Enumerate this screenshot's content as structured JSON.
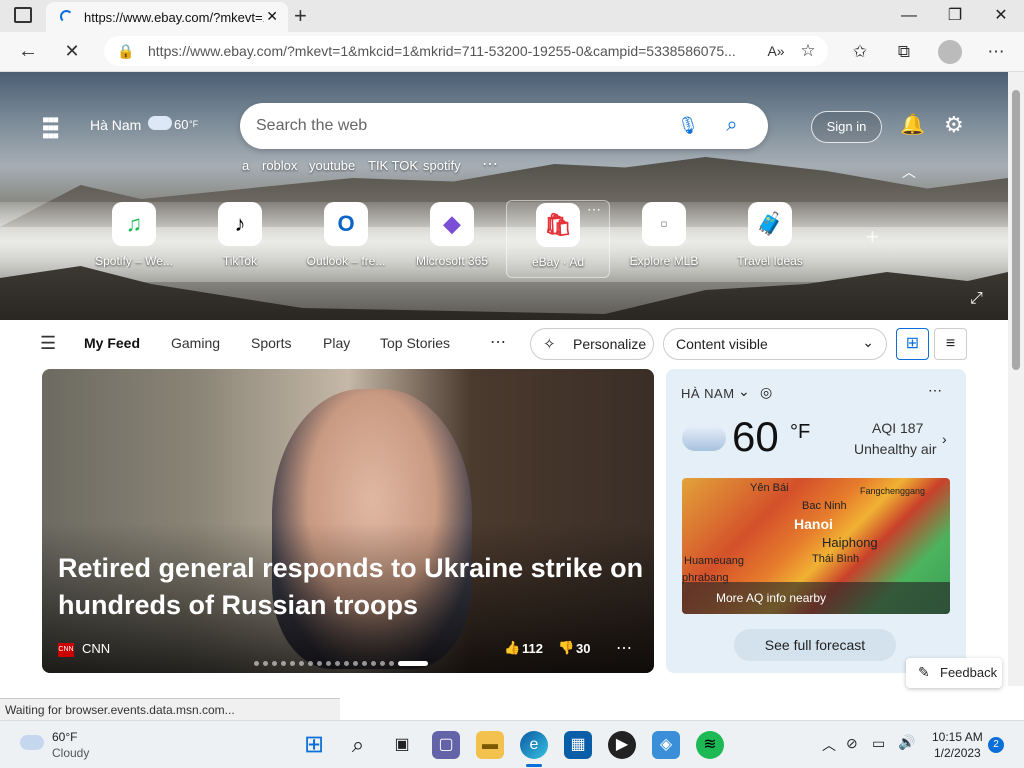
{
  "browser": {
    "tab_title": "https://www.ebay.com/?mkevt=1",
    "tab_close": "✕",
    "new_tab": "+",
    "url": "https://www.ebay.com/?mkevt=1&mkcid=1&mkrid=711-53200-19255-0&campid=5338586075...",
    "status": "Waiting for browser.events.data.msn.com..."
  },
  "hero": {
    "location": "Hà Nam",
    "temp": "60",
    "unit": "°F",
    "search_placeholder": "Search the web",
    "signin": "Sign in",
    "quick_links": [
      "a",
      "roblox",
      "youtube",
      "TIK TOK",
      "spotify"
    ],
    "tiles": [
      {
        "label": "Spotify – We...",
        "icon": "spotify-icon",
        "glyph": "♫",
        "color": "#1db954"
      },
      {
        "label": "TikTok",
        "icon": "tiktok-icon",
        "glyph": "♪",
        "color": "#000000"
      },
      {
        "label": "Outlook – fre...",
        "icon": "outlook-icon",
        "glyph": "O",
        "color": "#0a64c8"
      },
      {
        "label": "Microsoft 365",
        "icon": "microsoft365-icon",
        "glyph": "◆",
        "color": "#7b4ed8"
      },
      {
        "label": "eBay · Ad",
        "icon": "ebay-icon",
        "glyph": "🛍",
        "color": "#e53238"
      },
      {
        "label": "Explore MLB",
        "icon": "mlb-icon",
        "glyph": "▫",
        "color": "#999999"
      },
      {
        "label": "Travel Ideas",
        "icon": "travel-icon",
        "glyph": "🧳",
        "color": "#1e90ff"
      }
    ]
  },
  "feed": {
    "tabs": [
      "My Feed",
      "Gaming",
      "Sports",
      "Play",
      "Top Stories"
    ],
    "personalize": "Personalize",
    "content_visible": "Content visible"
  },
  "article": {
    "headline": "Retired general responds to Ukraine strike on hundreds of Russian troops",
    "source": "CNN",
    "source_logo": "CNN",
    "likes": "112",
    "dislikes": "30"
  },
  "weather": {
    "location": "HÀ NAM",
    "temp": "60",
    "unit": "°F",
    "aqi": "AQI 187",
    "aqi_status": "Unhealthy air",
    "map_labels": [
      "Yên Bái",
      "Bac Ninh",
      "Fangchenggang",
      "Hanoi",
      "Haiphong",
      "Thái Bình",
      "Huameuang",
      "phrabang"
    ],
    "aq_link": "More AQ info nearby",
    "forecast_button": "See full forecast"
  },
  "feedback": "Feedback",
  "taskbar": {
    "weather_temp": "60°F",
    "weather_desc": "Cloudy",
    "time": "10:15 AM",
    "date": "1/2/2023",
    "notifications": "2"
  }
}
